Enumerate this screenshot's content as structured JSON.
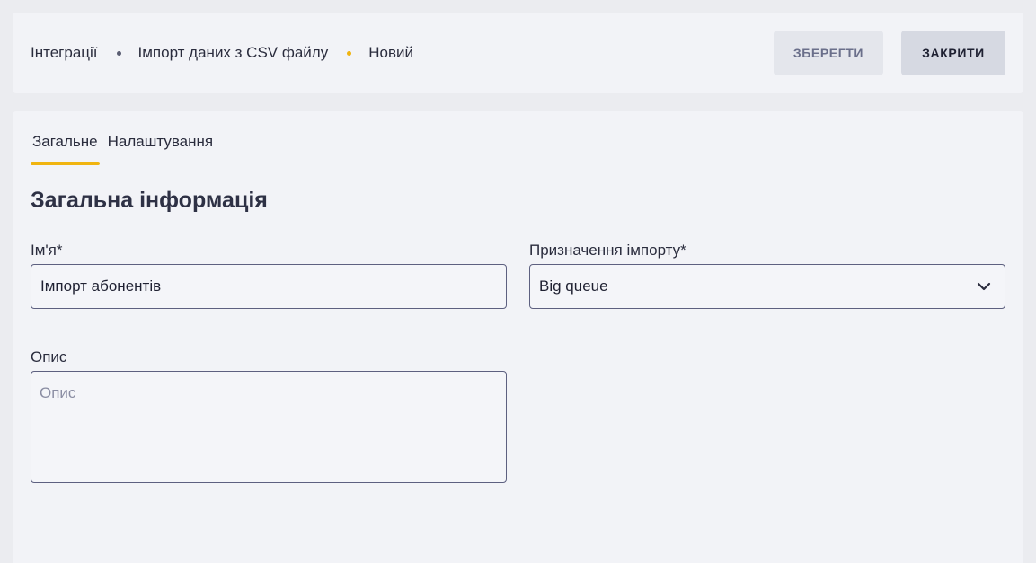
{
  "header": {
    "breadcrumbs": [
      "Інтеграції",
      "Імпорт даних з CSV файлу",
      "Новий"
    ],
    "save_label": "ЗБЕРЕГТИ",
    "close_label": "ЗАКРИТИ"
  },
  "tabs": [
    {
      "label": "Загальне",
      "active": true
    },
    {
      "label": "Налаштування",
      "active": false
    }
  ],
  "section": {
    "title": "Загальна інформація"
  },
  "form": {
    "name_label": "Ім'я*",
    "name_value": "Імпорт абонентів",
    "purpose_label": "Призначення імпорту*",
    "purpose_value": "Big queue",
    "description_label": "Опис",
    "description_placeholder": "Опис"
  },
  "colors": {
    "accent": "#f0b410",
    "background": "#ebecf0",
    "panel": "#f2f3f7"
  },
  "icons": {
    "select_chevron": "chevron-down-icon"
  }
}
